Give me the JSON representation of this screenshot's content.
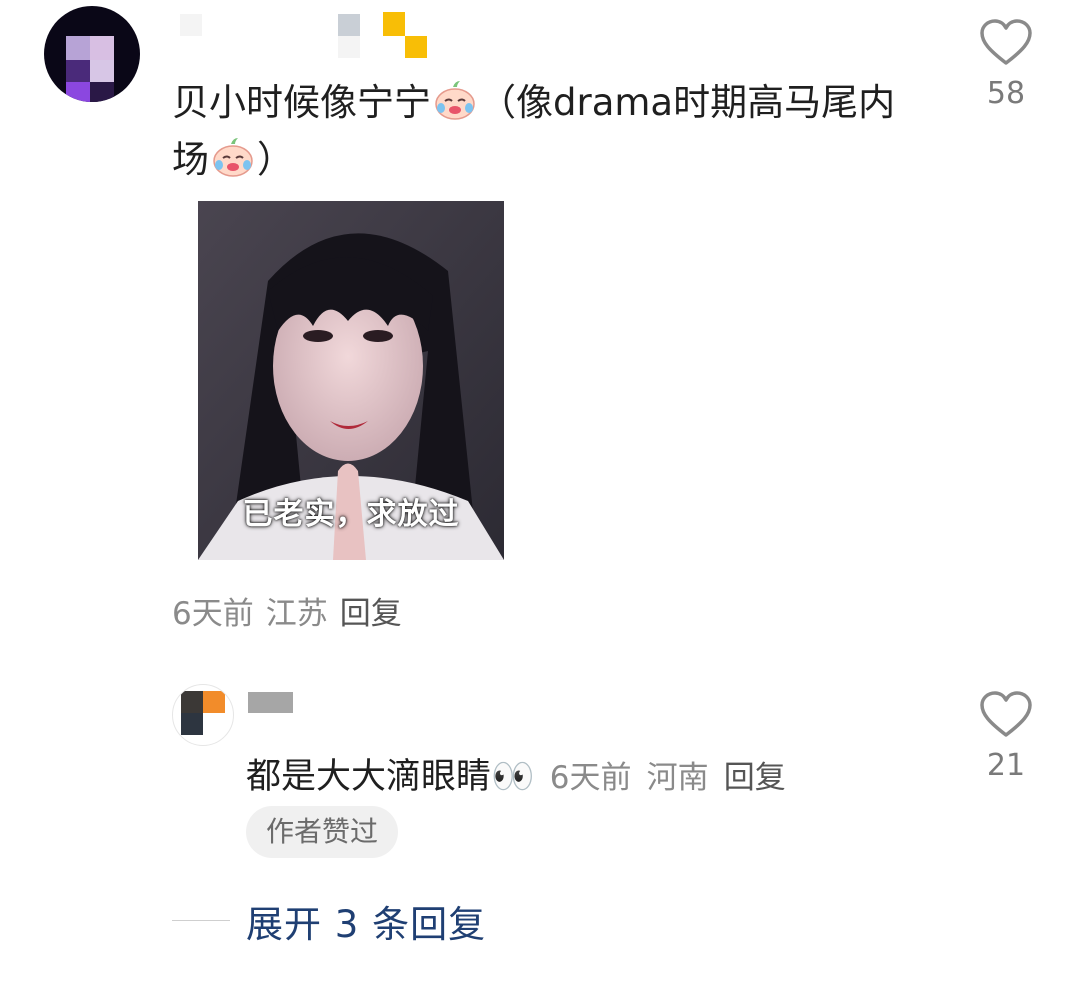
{
  "comment": {
    "text_part1": "贝小时候像宁宁",
    "text_part2": "（像drama时期高马尾内场",
    "text_part3": "）",
    "emoji_name": "crying-laughing-peach-emoji",
    "image_caption": "已老实，求放过",
    "time": "6天前",
    "location": "江苏",
    "reply_label": "回复",
    "like_count": "58"
  },
  "reply": {
    "text": "都是大大滴眼睛👀",
    "time": "6天前",
    "location": "河南",
    "reply_label": "回复",
    "badge": "作者赞过",
    "like_count": "21"
  },
  "expand": {
    "label": "展开 3 条回复"
  },
  "colors": {
    "link_blue": "#1f3f73",
    "meta_gray": "#8a8a8a",
    "badge_bg": "#f0f0f0"
  }
}
